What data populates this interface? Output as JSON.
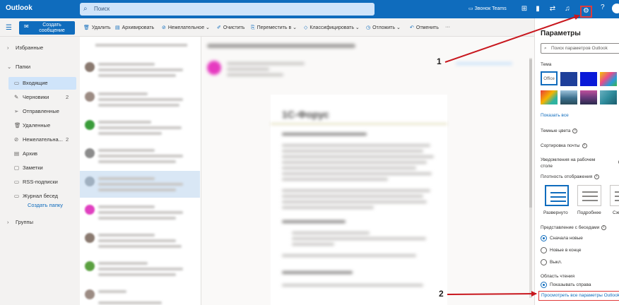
{
  "topbar": {
    "brand": "Outlook",
    "search_placeholder": "Поиск",
    "teams_call": "Звонок Teams",
    "help": "?"
  },
  "command_bar": {
    "new_message": "Создать сообщение",
    "items": [
      "Удалить",
      "Архивировать",
      "Нежелательное",
      "Очистить",
      "Переместить в",
      "Классифицировать",
      "Отложить",
      "Отменить"
    ],
    "more": "···"
  },
  "nav": {
    "favorites": "Избранные",
    "folders": "Папки",
    "items": [
      {
        "label": "Входящие",
        "count": ""
      },
      {
        "label": "Черновики",
        "count": "2"
      },
      {
        "label": "Отправленные",
        "count": ""
      },
      {
        "label": "Удаленные",
        "count": ""
      },
      {
        "label": "Нежелательна...",
        "count": "2"
      },
      {
        "label": "Архив",
        "count": ""
      },
      {
        "label": "Заметки",
        "count": ""
      },
      {
        "label": "RSS-подписки",
        "count": ""
      },
      {
        "label": "Журнал бесед",
        "count": ""
      }
    ],
    "create_folder": "Создать папку",
    "groups": "Группы"
  },
  "reading": {
    "doc_title": "1С-Форус"
  },
  "annotations": {
    "label1": "1",
    "label2": "2"
  },
  "settings": {
    "title": "Параметры",
    "search_placeholder": "Поиск параметров Outlook",
    "theme": "Тема",
    "theme_office": "Office",
    "show_all": "Показать все",
    "dark_colors": "Темные цвета",
    "sort_mail": "Сортировка почты",
    "desktop_notifications": "Уведомления на рабочем столе",
    "density": "Плотность отображения",
    "density_options": [
      "Развернуто",
      "Подробнее",
      "Сж"
    ],
    "conversations": "Представление с беседами",
    "conv_options": [
      "Сначала новые",
      "Новые в конце",
      "Выкл."
    ],
    "reading_pane": "Область чтения",
    "reading_option": "Показывать справа",
    "view_all": "Просмотреть все параметры Outlook"
  }
}
